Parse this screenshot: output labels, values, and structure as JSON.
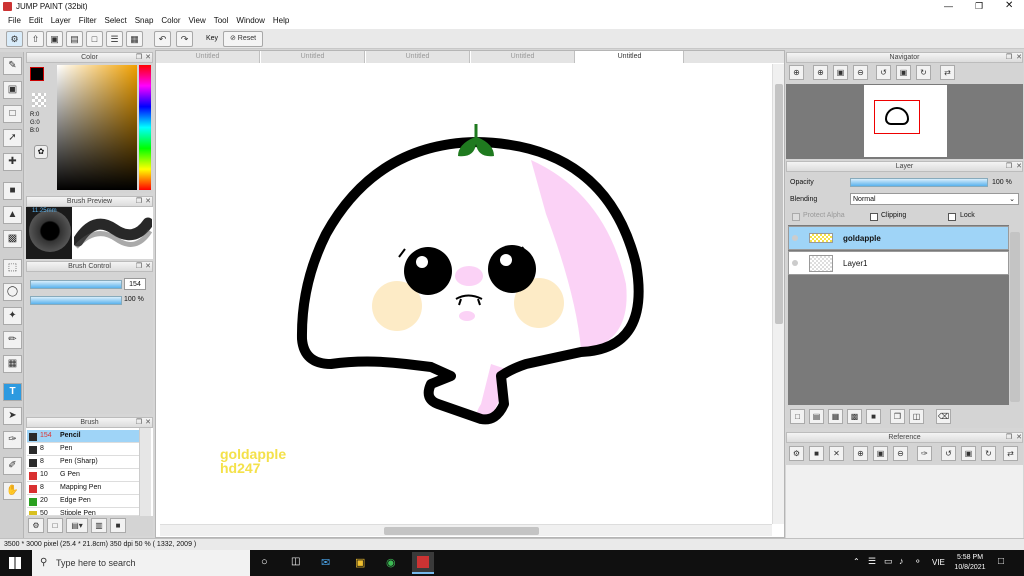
{
  "app": {
    "title": "JUMP PAINT (32bit)"
  },
  "menu": [
    "File",
    "Edit",
    "Layer",
    "Filter",
    "Select",
    "Snap",
    "Color",
    "View",
    "Tool",
    "Window",
    "Help"
  ],
  "toolbar": {
    "key_label": "Key",
    "reset_label": "Reset"
  },
  "panels": {
    "color": {
      "title": "Color",
      "r": "R:0",
      "g": "G:0",
      "b": "B:0"
    },
    "brush_preview": {
      "title": "Brush Preview",
      "size_label": "11.25mm"
    },
    "brush_control": {
      "title": "Brush Control",
      "size_value": "154",
      "opacity_value": "100 %"
    },
    "brush": {
      "title": "Brush",
      "items": [
        {
          "size": "154",
          "name": "Pencil",
          "color": "#2a2a2a"
        },
        {
          "size": "8",
          "name": "Pen",
          "color": "#2a2a2a"
        },
        {
          "size": "8",
          "name": "Pen (Sharp)",
          "color": "#2a2a2a"
        },
        {
          "size": "10",
          "name": "G Pen",
          "color": "#d93030"
        },
        {
          "size": "8",
          "name": "Mapping Pen",
          "color": "#d93030"
        },
        {
          "size": "20",
          "name": "Edge Pen",
          "color": "#2aa020"
        },
        {
          "size": "50",
          "name": "Stipple Pen",
          "color": "#d8c020"
        }
      ]
    },
    "navigator": {
      "title": "Navigator"
    },
    "layer": {
      "title": "Layer",
      "opacity_label": "Opacity",
      "opacity_value": "100 %",
      "blending_label": "Blending",
      "blending_value": "Normal",
      "protect_alpha": "Protect Alpha",
      "clipping": "Clipping",
      "lock": "Lock",
      "layers": [
        {
          "name": "goldapple",
          "selected": true
        },
        {
          "name": "Layer1",
          "selected": false
        }
      ]
    },
    "reference": {
      "title": "Reference"
    }
  },
  "tabs": [
    "Untitled",
    "Untitled",
    "Untitled",
    "Untitled",
    "Untitled"
  ],
  "canvas": {
    "watermark_line1": "goldapple",
    "watermark_line2": "hd247"
  },
  "status": {
    "text": "3500 * 3000 pixel   (25.4 * 21.8cm)   350 dpi   50 %   ( 1332, 2009 )"
  },
  "taskbar": {
    "search_placeholder": "Type here to search",
    "lang": "VIE",
    "time": "5:58 PM",
    "date": "10/8/2021"
  },
  "colors": {
    "accent": "#56b4ec",
    "selected_layer": "#9fd4f7",
    "watermark": "#f4e14a",
    "blush": "#fdebc6",
    "pink": "#fbd2f6",
    "leaf": "#1f7a1f"
  }
}
